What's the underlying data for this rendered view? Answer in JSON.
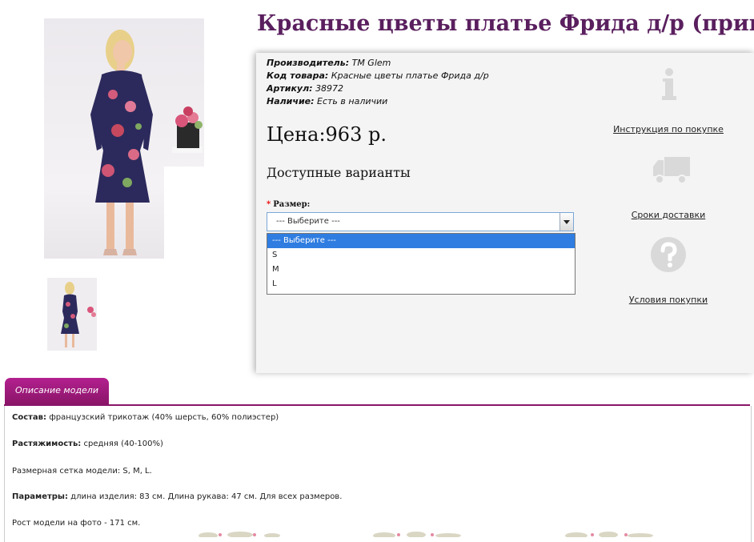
{
  "product": {
    "title": "Красные цветы платье Фрида д/р (принт)",
    "manufacturer_label": "Производитель:",
    "manufacturer_value": "TM Glem",
    "code_label": "Код товара:",
    "code_value": "Красные цветы платье Фрида д/р",
    "article_label": "Артикул:",
    "article_value": "38972",
    "availability_label": "Наличие:",
    "availability_value": "Есть в наличии",
    "price": "Цена:963 р.",
    "variants_heading": "Доступные варианты"
  },
  "size": {
    "required_mark": "*",
    "label": "Размер:",
    "selected": "--- Выберите ---",
    "options": [
      "--- Выберите ---",
      "S",
      "M",
      "L"
    ]
  },
  "side_links": {
    "instruction": "Инструкция по покупке",
    "delivery": "Сроки доставки",
    "conditions": "Условия покупки"
  },
  "tab": {
    "label": "Описание модели"
  },
  "description": {
    "composition_label": "Состав:",
    "composition_value": "французский трикотаж (40% шерсть, 60% полиэстер)",
    "stretch_label": "Растяжимость:",
    "stretch_value": "средняя (40-100%)",
    "sizes_line": "Размерная сетка модели: S, M, L.",
    "params_label": "Параметры:",
    "params_value": "длина изделия: 83 см. Длина рукава: 47 см. Для всех размеров.",
    "height_line": "Рост модели на фото - 171 см."
  },
  "colors": {
    "title": "#5a1f5e",
    "tab": "#8a1568",
    "dress": "#2c2a5c",
    "selected_option": "#2f7de1"
  }
}
